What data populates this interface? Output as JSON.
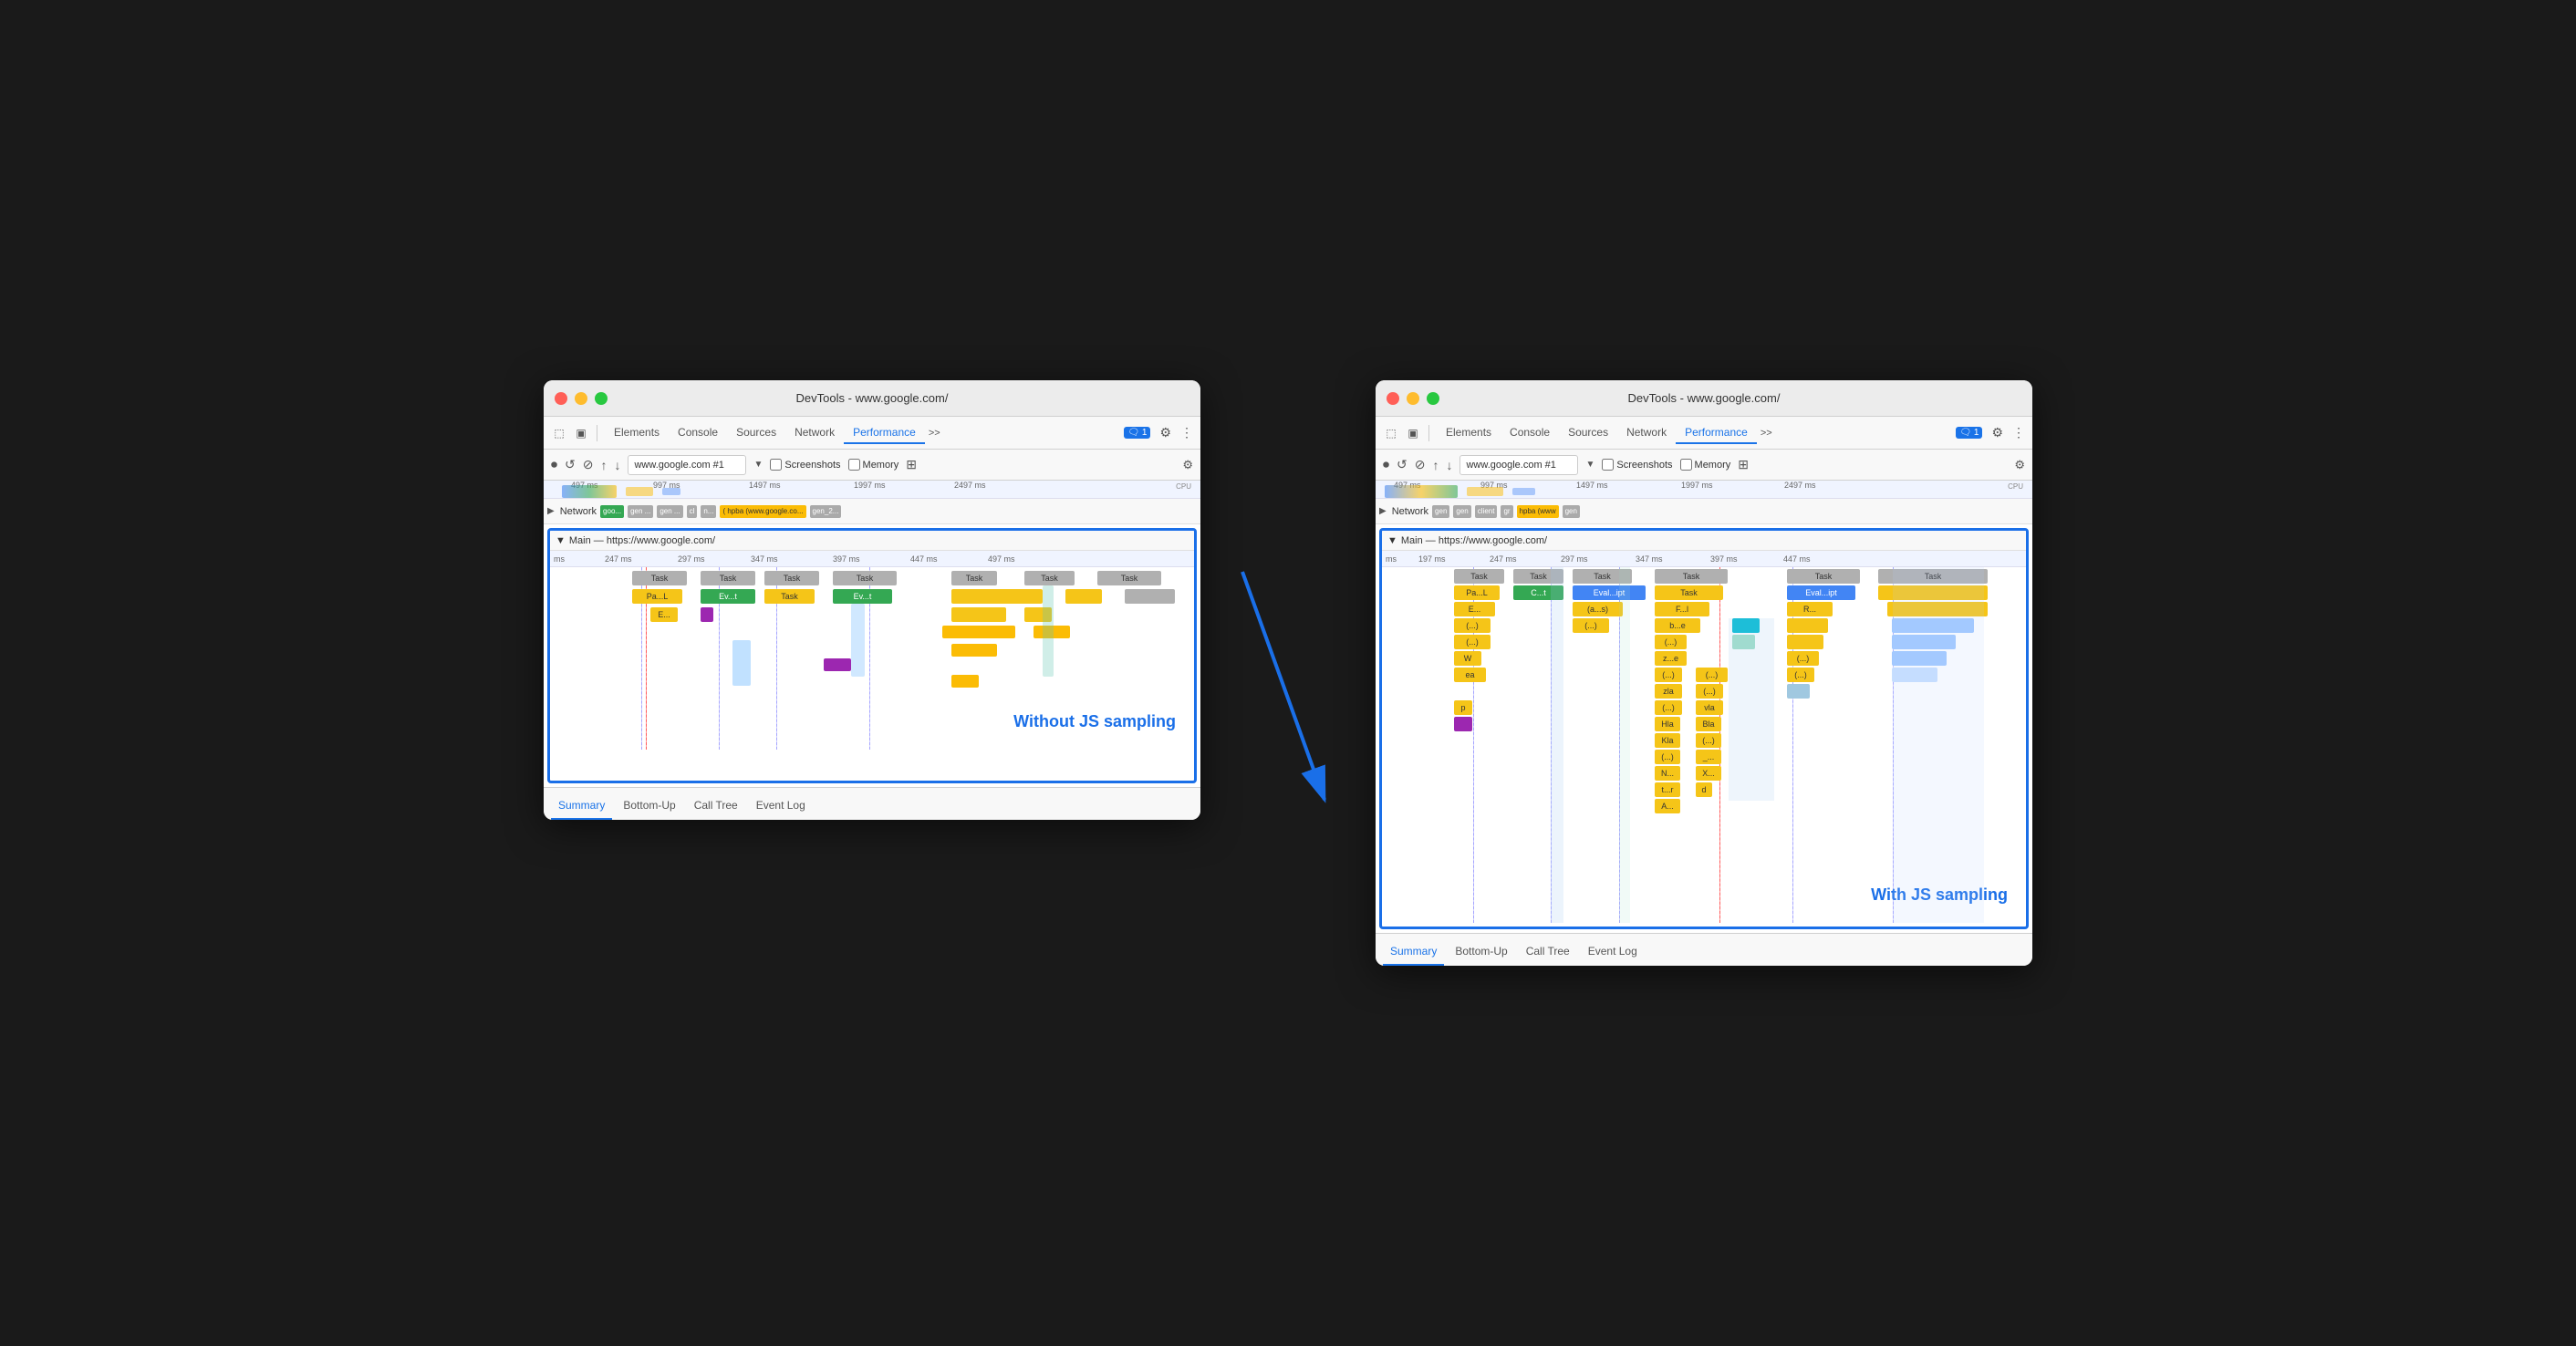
{
  "left_panel": {
    "title": "DevTools - www.google.com/",
    "toolbar_tabs": [
      "Elements",
      "Console",
      "Sources",
      "Network",
      "Performance"
    ],
    "active_tab": "Performance",
    "url_input": "www.google.com #1",
    "screenshots_label": "Screenshots",
    "memory_label": "Memory",
    "network_label": "Network",
    "main_label": "Main — https://www.google.com/",
    "annotation": "Without JS sampling",
    "bottom_tabs": [
      "Summary",
      "Bottom-Up",
      "Call Tree",
      "Event Log"
    ],
    "active_bottom_tab": "Summary",
    "ruler_marks": [
      "ms",
      "247 ms",
      "297 ms",
      "347 ms",
      "397 ms",
      "447 ms",
      "497 ms"
    ],
    "top_ruler_marks": [
      "497 ms",
      "997 ms",
      "1497 ms",
      "1997 ms",
      "2497 ms"
    ],
    "net_chips": [
      "goo...",
      "gen ...",
      "gen ...",
      "cl",
      "n...",
      "( hpba (www.google.co...",
      "gen_2..."
    ],
    "tasks_row1": [
      "Task",
      "Task",
      "Task",
      "Task"
    ],
    "tasks_row2": [
      "Pa...L",
      "Ev...t",
      "Task",
      "Ev...t"
    ],
    "tasks_row3": [
      "E..."
    ]
  },
  "right_panel": {
    "title": "DevTools - www.google.com/",
    "toolbar_tabs": [
      "Elements",
      "Console",
      "Sources",
      "Network",
      "Performance"
    ],
    "active_tab": "Performance",
    "url_input": "www.google.com #1",
    "screenshots_label": "Screenshots",
    "memory_label": "Memory",
    "network_label": "Network",
    "main_label": "Main — https://www.google.com/",
    "annotation": "With JS sampling",
    "bottom_tabs": [
      "Summary",
      "Bottom-Up",
      "Call Tree",
      "Event Log"
    ],
    "active_bottom_tab": "Summary",
    "ruler_marks": [
      "ms",
      "197 ms",
      "247 ms",
      "297 ms",
      "347 ms",
      "397 ms",
      "447 ms"
    ],
    "top_ruler_marks": [
      "497 ms",
      "997 ms",
      "1497 ms",
      "1997 ms",
      "2497 ms"
    ],
    "net_chips": [
      "gen",
      "gen",
      "client",
      "gr",
      "hpba (www",
      "gen"
    ],
    "left_tasks": [
      "Pa...L",
      "E...",
      "(...)",
      "(...)",
      "(...)",
      "W",
      "ea",
      "",
      "p"
    ],
    "mid_tasks": [
      "C...t",
      "",
      "(a...s)",
      "(...)",
      "",
      "",
      "",
      "",
      ""
    ],
    "right_tasks": [
      "Eval...ipt",
      "",
      "",
      "z...e",
      "(...)",
      "(...)",
      "zla",
      "(...)",
      "vla",
      "Hla",
      "Bla",
      "Kla",
      "(...)",
      "_...",
      "N...",
      "X...",
      "t...r",
      "d",
      "A..."
    ],
    "right2_tasks": [
      "Eval...ipt",
      "R...",
      "b...e",
      "",
      "",
      "",
      "",
      "",
      ""
    ]
  },
  "colors": {
    "accent": "#1a6fe8",
    "task_gray": "#b0b0b0",
    "task_yellow": "#f5c518",
    "task_green": "#34a853",
    "task_blue": "#4285f4",
    "task_purple": "#9c27b0",
    "task_teal": "#00bcd4",
    "annotation_text": "#1a6fe8"
  }
}
